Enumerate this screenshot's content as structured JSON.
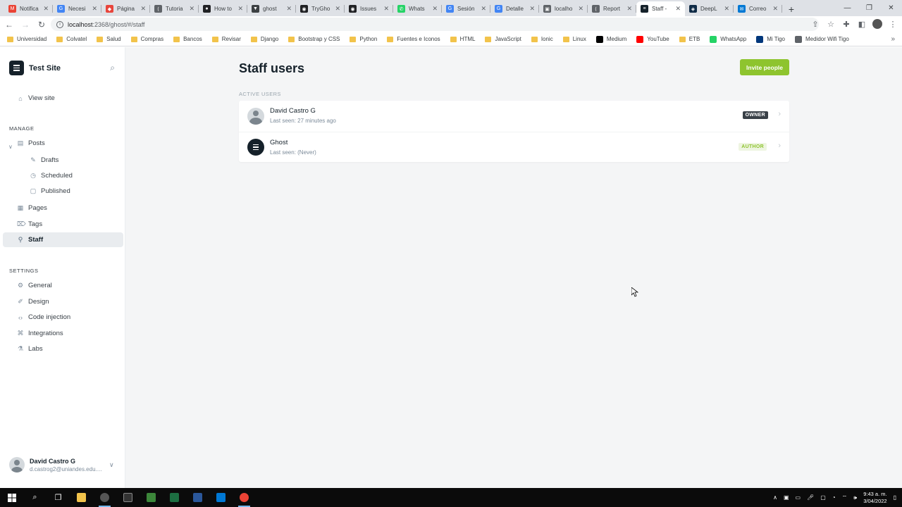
{
  "browser": {
    "tabs": [
      {
        "title": "Notifica",
        "color": "#ea4335",
        "glyph": "M"
      },
      {
        "title": "Necesi",
        "color": "#4285f4",
        "glyph": "G"
      },
      {
        "title": "Página",
        "color": "#e8453c",
        "glyph": "◆"
      },
      {
        "title": "Tutoria",
        "color": "#5f6368",
        "glyph": "⟨"
      },
      {
        "title": "How to",
        "color": "#202124",
        "glyph": "●"
      },
      {
        "title": "ghost",
        "color": "#3c4043",
        "glyph": "▼"
      },
      {
        "title": "TryGho",
        "color": "#202124",
        "glyph": "◉"
      },
      {
        "title": "Issues",
        "color": "#202124",
        "glyph": "◉"
      },
      {
        "title": "Whats",
        "color": "#25d366",
        "glyph": "✆"
      },
      {
        "title": "Sesión",
        "color": "#4285f4",
        "glyph": "G"
      },
      {
        "title": "Detalle",
        "color": "#4285f4",
        "glyph": "G"
      },
      {
        "title": "localho",
        "color": "#5f6368",
        "glyph": "▣"
      },
      {
        "title": "Report",
        "color": "#5f6368",
        "glyph": "⟨"
      },
      {
        "title": "Staff -",
        "color": "#15212a",
        "glyph": "≡",
        "active": true
      },
      {
        "title": "DeepL",
        "color": "#0f2b46",
        "glyph": "◈"
      },
      {
        "title": "Correo",
        "color": "#0078d4",
        "glyph": "✉"
      }
    ],
    "new_tab": "+",
    "url_host": "localhost",
    "url_path": ":2368/ghost/#/staff",
    "bookmarks": [
      {
        "label": "Universidad",
        "type": "folder"
      },
      {
        "label": "Colvatel",
        "type": "folder"
      },
      {
        "label": "Salud",
        "type": "folder"
      },
      {
        "label": "Compras",
        "type": "folder"
      },
      {
        "label": "Bancos",
        "type": "folder"
      },
      {
        "label": "Revisar",
        "type": "folder"
      },
      {
        "label": "Django",
        "type": "folder"
      },
      {
        "label": "Bootstrap y CSS",
        "type": "folder"
      },
      {
        "label": "Python",
        "type": "folder"
      },
      {
        "label": "Fuentes e Iconos",
        "type": "folder"
      },
      {
        "label": "HTML",
        "type": "folder"
      },
      {
        "label": "JavaScript",
        "type": "folder"
      },
      {
        "label": "Ionic",
        "type": "folder"
      },
      {
        "label": "Linux",
        "type": "folder"
      },
      {
        "label": "Medium",
        "type": "icon",
        "color": "#000000"
      },
      {
        "label": "YouTube",
        "type": "icon",
        "color": "#ff0000"
      },
      {
        "label": "ETB",
        "type": "folder"
      },
      {
        "label": "WhatsApp",
        "type": "icon",
        "color": "#25d366"
      },
      {
        "label": "Mi Tigo",
        "type": "icon",
        "color": "#00377b"
      },
      {
        "label": "Medidor Wifi Tigo",
        "type": "icon",
        "color": "#5f6368"
      }
    ]
  },
  "sidebar": {
    "site_name": "Test Site",
    "view_site": "View site",
    "manage_label": "MANAGE",
    "posts": "Posts",
    "drafts": "Drafts",
    "scheduled": "Scheduled",
    "published": "Published",
    "pages": "Pages",
    "tags": "Tags",
    "staff": "Staff",
    "settings_label": "SETTINGS",
    "general": "General",
    "design": "Design",
    "code_injection": "Code injection",
    "integrations": "Integrations",
    "labs": "Labs",
    "user_name": "David Castro G",
    "user_email": "d.castrog2@uniandes.edu...."
  },
  "main": {
    "title": "Staff users",
    "invite_label": "Invite people",
    "section_label": "ACTIVE USERS",
    "users": [
      {
        "name": "David Castro G",
        "last_seen": "Last seen: 27 minutes ago",
        "role": "OWNER"
      },
      {
        "name": "Ghost",
        "last_seen": "Last seen: (Never)",
        "role": "AUTHOR"
      }
    ]
  },
  "taskbar": {
    "time": "9:43 a. m.",
    "date": "3/04/2022"
  },
  "colors": {
    "accent_green": "#8ec42e",
    "dark": "#15212a",
    "owner_badge": "#394047"
  }
}
